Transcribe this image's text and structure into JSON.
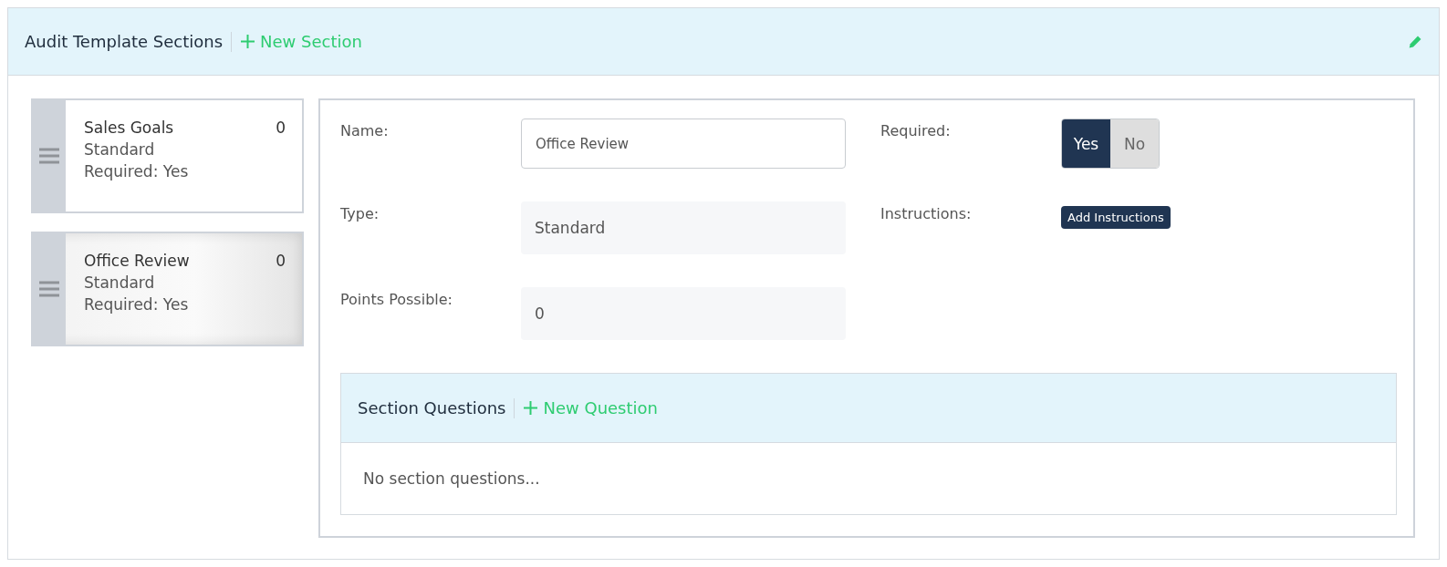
{
  "header": {
    "title": "Audit Template Sections",
    "new_link": "New Section"
  },
  "sections": [
    {
      "name": "Sales Goals",
      "count": "0",
      "type": "Standard",
      "required": "Required: Yes",
      "selected": false
    },
    {
      "name": "Office Review",
      "count": "0",
      "type": "Standard",
      "required": "Required: Yes",
      "selected": true
    }
  ],
  "form": {
    "name": {
      "label": "Name:",
      "value": "Office Review"
    },
    "type": {
      "label": "Type:",
      "value": "Standard"
    },
    "points": {
      "label": "Points Possible:",
      "value": "0"
    },
    "required": {
      "label": "Required:",
      "options": [
        {
          "label": "Yes",
          "selected": true
        },
        {
          "label": "No",
          "selected": false
        }
      ]
    },
    "instructions": {
      "label": "Instructions:",
      "button": "Add Instructions"
    }
  },
  "questions": {
    "title": "Section Questions",
    "new_link": "New Question",
    "empty": "No section questions..."
  }
}
